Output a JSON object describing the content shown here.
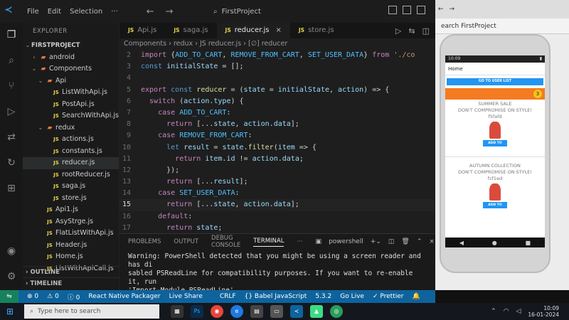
{
  "titlebar": {
    "menu": [
      "File",
      "Edit",
      "Selection"
    ],
    "more": "···",
    "search": "FirstProject"
  },
  "sidebar": {
    "header": "EXPLORER",
    "tree": [
      {
        "label": "FIRSTPROJECT",
        "indent": 0,
        "twist": "⌄",
        "type": "root"
      },
      {
        "label": "android",
        "indent": 1,
        "twist": "›",
        "type": "folder"
      },
      {
        "label": "Components",
        "indent": 1,
        "twist": "⌄",
        "type": "folder"
      },
      {
        "label": "Api",
        "indent": 2,
        "twist": "⌄",
        "type": "folder"
      },
      {
        "label": "ListWithApi.js",
        "indent": 3,
        "type": "js"
      },
      {
        "label": "PostApi.js",
        "indent": 3,
        "type": "js"
      },
      {
        "label": "SearchWithApi.js",
        "indent": 3,
        "type": "js"
      },
      {
        "label": "redux",
        "indent": 2,
        "twist": "⌄",
        "type": "folder"
      },
      {
        "label": "actions.js",
        "indent": 3,
        "type": "js"
      },
      {
        "label": "constants.js",
        "indent": 3,
        "type": "js"
      },
      {
        "label": "reducer.js",
        "indent": 3,
        "type": "js",
        "selected": true
      },
      {
        "label": "rootReducer.js",
        "indent": 3,
        "type": "js"
      },
      {
        "label": "saga.js",
        "indent": 3,
        "type": "js"
      },
      {
        "label": "store.js",
        "indent": 3,
        "type": "js"
      },
      {
        "label": "Api1.js",
        "indent": 2,
        "type": "js"
      },
      {
        "label": "AsyStrge.js",
        "indent": 2,
        "type": "js"
      },
      {
        "label": "FlatListWithApi.js",
        "indent": 2,
        "type": "js"
      },
      {
        "label": "Header.js",
        "indent": 2,
        "type": "js"
      },
      {
        "label": "Home.js",
        "indent": 2,
        "type": "js"
      },
      {
        "label": "ListWithApiCall.js",
        "indent": 2,
        "type": "js"
      }
    ],
    "outline": "OUTLINE",
    "timeline": "TIMELINE"
  },
  "tabs": [
    {
      "label": "Api.js",
      "active": false
    },
    {
      "label": "saga.js",
      "active": false
    },
    {
      "label": "reducer.js",
      "active": true
    },
    {
      "label": "store.js",
      "active": false
    }
  ],
  "breadcrumb": "Components › redux › JS reducer.js › [∅] reducer",
  "code": [
    {
      "n": "2",
      "html": "<span class='kw'>import</span> <span class='op'>{</span><span class='const'>ADD_TO_CART</span><span class='op'>, </span><span class='const'>REMOVE_FROM_CART</span><span class='op'>, </span><span class='const'>SET_USER_DATA</span><span class='op'>}</span> <span class='kw'>from</span> <span class='str'>'./co</span>"
    },
    {
      "n": "3",
      "html": "<span class='kw2'>const</span> <span class='txt'>initialState</span> <span class='op'>= [];</span>"
    },
    {
      "n": "4",
      "html": ""
    },
    {
      "n": "5",
      "html": "<span class='kw'>export</span> <span class='kw2'>const</span> <span class='fn'>reducer</span> <span class='op'>= (</span><span class='txt'>state</span> <span class='op'>=</span> <span class='txt'>initialState</span><span class='op'>, </span><span class='txt'>action</span><span class='op'>) =&gt; {</span>"
    },
    {
      "n": "6",
      "html": "  <span class='kw'>switch</span> <span class='op'>(</span><span class='txt'>action</span><span class='op'>.</span><span class='txt'>type</span><span class='op'>) {</span>"
    },
    {
      "n": "7",
      "html": "    <span class='kw'>case</span> <span class='const'>ADD_TO_CART</span><span class='op'>:</span>"
    },
    {
      "n": "8",
      "html": "      <span class='kw'>return</span> <span class='op'>[...</span><span class='txt'>state</span><span class='op'>, </span><span class='txt'>action</span><span class='op'>.</span><span class='txt'>data</span><span class='op'>];</span>"
    },
    {
      "n": "9",
      "html": "    <span class='kw'>case</span> <span class='const'>REMOVE_FROM_CART</span><span class='op'>:</span>"
    },
    {
      "n": "10",
      "html": "      <span class='kw2'>let</span> <span class='txt'>result</span> <span class='op'>=</span> <span class='txt'>state</span><span class='op'>.</span><span class='fn'>filter</span><span class='op'>(</span><span class='txt'>item</span> <span class='op'>=&gt; {</span>"
    },
    {
      "n": "11",
      "html": "        <span class='kw'>return</span> <span class='txt'>item</span><span class='op'>.</span><span class='txt'>id</span> <span class='op'>!=</span> <span class='txt'>action</span><span class='op'>.</span><span class='txt'>data</span><span class='op'>;</span>"
    },
    {
      "n": "12",
      "html": "      <span class='op'>});</span>"
    },
    {
      "n": "13",
      "html": "      <span class='kw'>return</span> <span class='op'>[...</span><span class='txt'>result</span><span class='op'>];</span>"
    },
    {
      "n": "14",
      "html": "    <span class='kw'>case</span> <span class='const'>SET_USER_DATA</span><span class='op'>:</span>"
    },
    {
      "n": "15",
      "html": "      <span class='kw'>return</span> <span class='op'>[...</span><span class='txt'>state</span><span class='op'>, </span><span class='txt'>action</span><span class='op'>.</span><span class='txt'>data</span><span class='op'>];</span>",
      "current": true
    },
    {
      "n": "16",
      "html": "    <span class='kw'>default</span><span class='op'>:</span>"
    },
    {
      "n": "17",
      "html": "      <span class='kw'>return</span> <span class='txt'>state</span><span class='op'>;</span>"
    },
    {
      "n": "18",
      "html": "  <span class='op'>}</span>"
    },
    {
      "n": "19",
      "html": "<span class='op'>};</span>"
    }
  ],
  "panel": {
    "tabs": [
      "PROBLEMS",
      "OUTPUT",
      "DEBUG CONSOLE",
      "TERMINAL"
    ],
    "shell": "powershell",
    "terminal_lines": [
      "Warning: PowerShell detected that you might be using a screen reader and has di",
      "sabled PSReadLine for compatibility purposes. If you want to re-enable it, run",
      "'Import-Module PSReadLine'."
    ]
  },
  "statusbar": {
    "errors": "⊗ 0",
    "warnings": "⚠ 0",
    "info": "ⓘ 0",
    "packager": "React Native Packager",
    "liveshare": "Live Share",
    "eol": "CRLF",
    "language": "{} Babel JavaScript",
    "version": "5.3.2",
    "golive": "Go Live",
    "prettier": "✓ Prettier"
  },
  "emulator": {
    "search": "earch FirstProject",
    "phone_time": "10:09",
    "app_title": "Home",
    "go_button": "GO TO USER LIST",
    "badge_count": "3",
    "cards": [
      {
        "title": "SUMMER SALE",
        "subtitle": "DON'T COMPROMISE ON STYLE!",
        "code": "f5fafd",
        "button": "ADD TO CART"
      },
      {
        "title": "AUTUMN COLLECTION",
        "subtitle": "DON'T COMPROMISE ON STYLE!",
        "code": "fcf1ed",
        "button": "ADD TO CART"
      }
    ]
  },
  "taskbar": {
    "search_placeholder": "Type here to search",
    "time": "10:09",
    "date": "16-01-2024"
  }
}
